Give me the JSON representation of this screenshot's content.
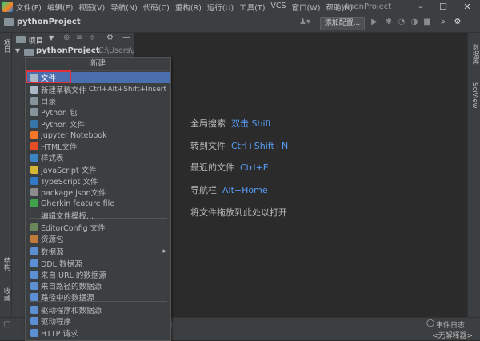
{
  "titlebar": {
    "menus": [
      "文件(F)",
      "编辑(E)",
      "视图(V)",
      "导航(N)",
      "代码(C)",
      "重构(R)",
      "运行(U)",
      "工具(T)",
      "VCS",
      "窗口(W)",
      "帮助(H)"
    ],
    "window_title": "pythonProject",
    "min": "–",
    "max": "☐",
    "close": "✕"
  },
  "navbar": {
    "project": "pythonProject",
    "add_config": "添加配置..."
  },
  "project_panel": {
    "label": "项目",
    "root_name": "pythonProject",
    "root_path": "C:\\Users\\Adn"
  },
  "left_stripe": {
    "project": "项目",
    "structure": "结构",
    "favorites": "收藏"
  },
  "right_stripe": {
    "database": "数据库",
    "sciview": "SciView"
  },
  "editor_hints": [
    {
      "label": "全局搜索",
      "key": "双击 Shift"
    },
    {
      "label": "转到文件",
      "key": "Ctrl+Shift+N"
    },
    {
      "label": "最近的文件",
      "key": "Ctrl+E"
    },
    {
      "label": "导航栏",
      "key": "Alt+Home"
    },
    {
      "label": "将文件拖放到此处以打开",
      "key": ""
    }
  ],
  "status": {
    "event_log": "事件日志",
    "interpreter": "<无解释器>"
  },
  "menu": {
    "header": "新建",
    "items": [
      {
        "label": "文件",
        "icon": "file-icon",
        "color": "#a9b7c6",
        "selected": true
      },
      {
        "label": "新建草稿文件",
        "shortcut": "Ctrl+Alt+Shift+Insert",
        "icon": "scratch-file-icon",
        "color": "#a9b7c6"
      },
      {
        "label": "目录",
        "icon": "folder-icon",
        "color": "#87939a"
      },
      {
        "label": "Python 包",
        "icon": "package-icon",
        "color": "#87939a"
      },
      {
        "label": "Python 文件",
        "icon": "python-icon",
        "color": "#3776ab"
      },
      {
        "label": "Jupyter Notebook",
        "icon": "jupyter-icon",
        "color": "#f37726"
      },
      {
        "label": "HTML文件",
        "icon": "html-icon",
        "color": "#e44d26"
      },
      {
        "label": "样式表",
        "icon": "css-icon",
        "color": "#3a85c6"
      },
      {
        "label": "JavaScript 文件",
        "icon": "javascript-icon",
        "color": "#d4b635"
      },
      {
        "label": "TypeScript 文件",
        "icon": "typescript-icon",
        "color": "#3178c6"
      },
      {
        "label": "package.json文件",
        "icon": "npm-icon",
        "color": "#8c8c8c"
      },
      {
        "label": "Gherkin feature file",
        "icon": "gherkin-icon",
        "color": "#3fa34d"
      },
      {
        "label": "编辑文件模板...",
        "icon": "",
        "color": ""
      },
      {
        "label": "EditorConfig 文件",
        "icon": "editorconfig-icon",
        "color": "#6a8759"
      },
      {
        "label": "资源包",
        "icon": "resource-bundle-icon",
        "color": "#c27a3a"
      },
      {
        "label": "数据源",
        "icon": "datasource-icon",
        "color": "#5b8fd1",
        "submenu": true
      },
      {
        "label": "DDL 数据源",
        "icon": "ddl-icon",
        "color": "#5b8fd1"
      },
      {
        "label": "来自 URL 的数据源",
        "icon": "url-datasource-icon",
        "color": "#5b8fd1"
      },
      {
        "label": "来自路径的数据源",
        "icon": "path-datasource-icon",
        "color": "#5b8fd1"
      },
      {
        "label": "路径中的数据源",
        "icon": "datasource-in-path-icon",
        "color": "#5b8fd1"
      },
      {
        "label": "驱动程序和数据源",
        "icon": "driver-datasource-icon",
        "color": "#5b8fd1"
      },
      {
        "label": "驱动程序",
        "icon": "driver-icon",
        "color": "#5b8fd1"
      },
      {
        "label": "HTTP 请求",
        "icon": "http-request-icon",
        "color": "#5b8fd1"
      }
    ]
  }
}
